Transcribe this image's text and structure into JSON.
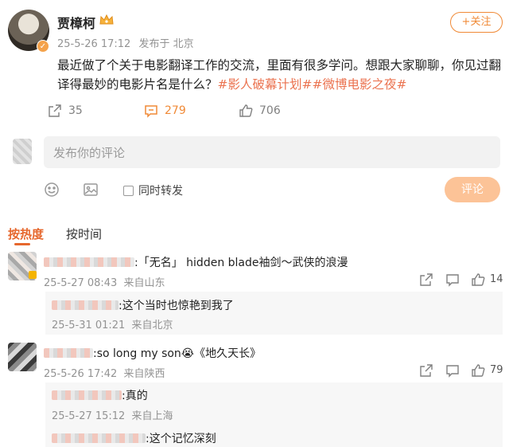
{
  "post": {
    "username": "贾樟柯",
    "time": "25-5-26 17:12",
    "source": "发布于 北京",
    "follow_label": "+关注",
    "text": "最近做了个关于电影翻译工作的交流，里面有很多学问。想跟大家聊聊，你见过翻译得最妙的电影片名是什么？",
    "topic1": "#影人破幕计划#",
    "topic2": "#微博电影之夜#",
    "reposts": "35",
    "comments": "279",
    "likes": "706"
  },
  "composer": {
    "placeholder": "发布你的评论",
    "repost_label": "同时转发",
    "submit_label": "评论"
  },
  "sort": {
    "hot": "按热度",
    "time": "按时间"
  },
  "comments": [
    {
      "text": ":「无名」 hidden blade袖剑～武侠的浪漫",
      "time": "25-5-27 08:43",
      "location": "来自山东",
      "likes": "14",
      "reply": {
        "text": ":这个当时也惊艳到我了",
        "time": "25-5-31 01:21",
        "location": "来自北京"
      }
    },
    {
      "text": ":so long my son😭《地久天长》",
      "time": "25-5-26 17:42",
      "location": "来自陕西",
      "likes": "79",
      "replies": [
        {
          "text": ":真的",
          "time": "25-5-27 15:12",
          "location": "来自上海"
        },
        {
          "text": ":这个记忆深刻"
        }
      ]
    }
  ],
  "colors": {
    "accent": "#f08a37",
    "topic": "#eb7350",
    "meta": "#939393"
  }
}
